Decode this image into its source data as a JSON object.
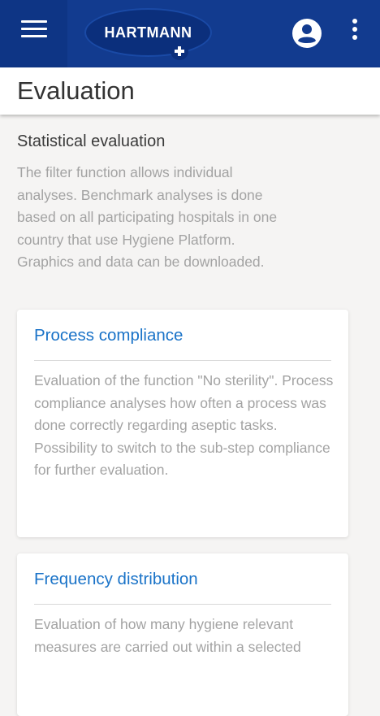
{
  "app": {
    "brand": "HARTMANN",
    "menu_icon": "hamburger-menu-icon",
    "account_icon": "account-circle-icon",
    "more_icon": "more-vertical-icon",
    "colors": {
      "header_bg": "#123b8f",
      "link_blue": "#1a73c8"
    }
  },
  "page": {
    "title": "Evaluation"
  },
  "intro": {
    "title": "Statistical evaluation",
    "description": "The filter function allows individual analyses. Benchmark analyses is done based on all participating hospitals in one country that use Hygiene Platform. Graphics and data can be downloaded."
  },
  "cards": [
    {
      "title": "Process compliance",
      "description": "Evaluation of the function \"No sterility\". Process compliance analyses how often a process was done correctly regarding aseptic tasks. Possibility to switch to the sub-step compliance for further evaluation."
    },
    {
      "title": "Frequency distribution",
      "description": "Evaluation of how many hygiene relevant measures are carried out within a selected"
    }
  ]
}
